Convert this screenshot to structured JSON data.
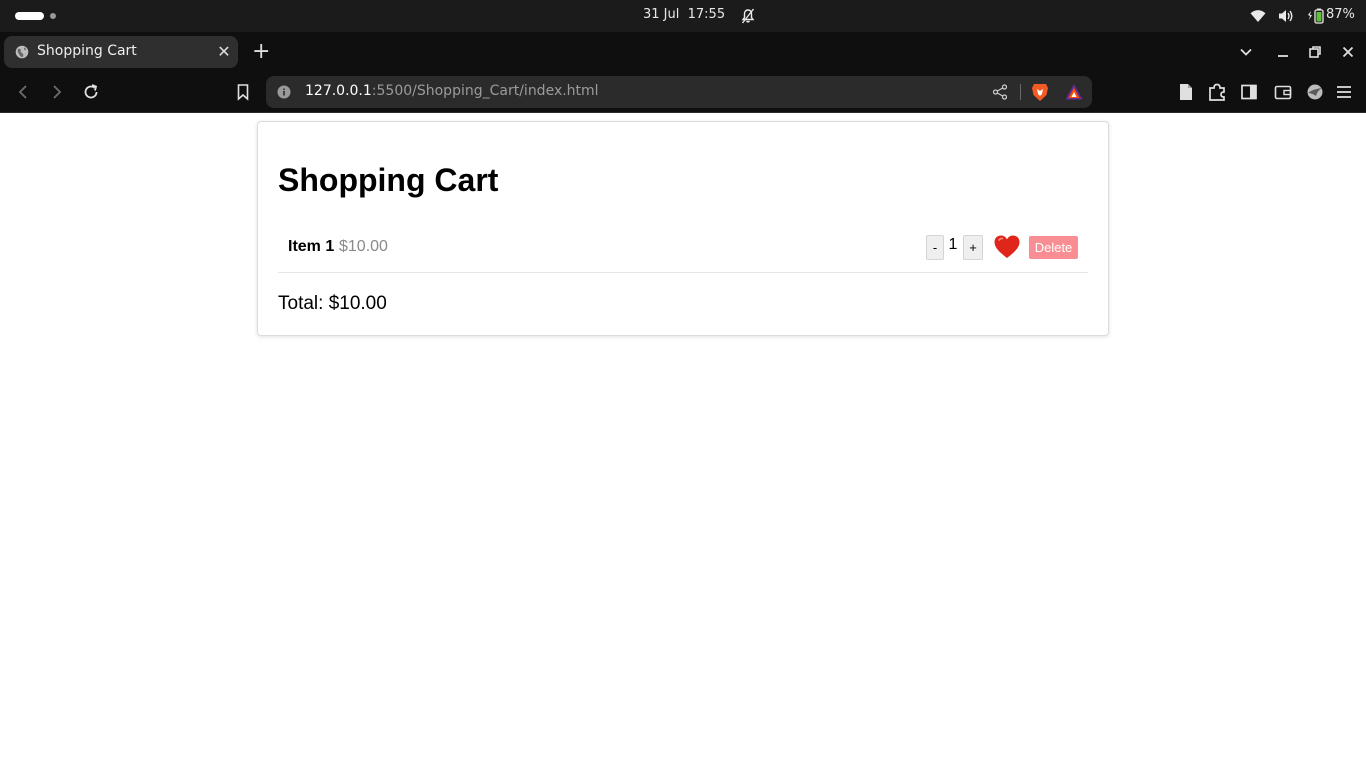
{
  "os": {
    "date": "31 Jul",
    "time": "17:55",
    "battery": "87%",
    "icons": [
      "notifications-muted-icon",
      "wifi-icon",
      "volume-icon",
      "battery-icon"
    ]
  },
  "browser": {
    "tab_title": "Shopping Cart",
    "address_host": "127.0.0.1",
    "address_rest": ":5500/Shopping_Cart/index.html",
    "window_controls": [
      "minimize",
      "restore",
      "close"
    ]
  },
  "cart": {
    "title": "Shopping Cart",
    "items": [
      {
        "name": "Item 1",
        "price": "$10.00",
        "quantity": "1",
        "decrement_label": "-",
        "increment_label": "+",
        "favorite_icon": "heart-icon",
        "delete_label": "Delete"
      }
    ],
    "total_label": "Total: $10.00"
  },
  "colors": {
    "delete_button": "#f88d93",
    "heart": "#e0251b",
    "price_text": "#8a8a8a"
  }
}
